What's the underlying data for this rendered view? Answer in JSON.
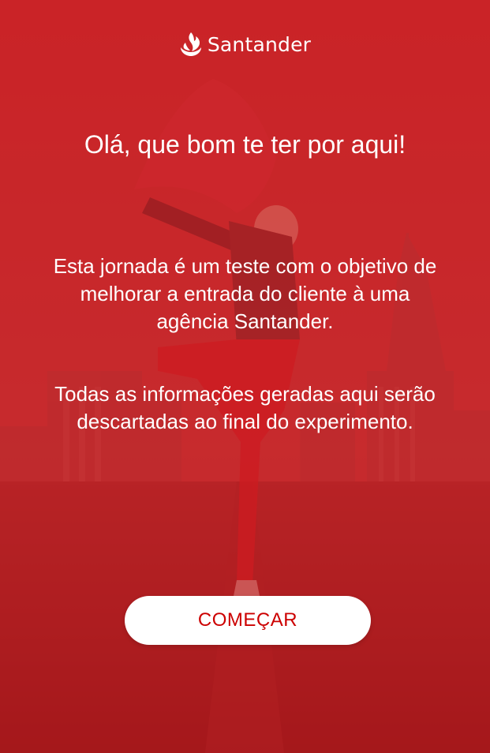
{
  "brand": {
    "name": "Santander",
    "icon": "santander-flame-icon"
  },
  "welcome": {
    "greeting": "Olá, que bom te ter por aqui!",
    "paragraph1": "Esta jornada é um teste com o objetivo de melhorar a entrada do cliente à uma agência Santander.",
    "paragraph2": "Todas as informações geradas aqui serão descartadas ao final do experimento."
  },
  "actions": {
    "start_label": "COMEÇAR"
  },
  "colors": {
    "brand_red": "#cc0000",
    "overlay_red": "#c41216",
    "text": "#ffffff",
    "button_bg": "#ffffff"
  }
}
